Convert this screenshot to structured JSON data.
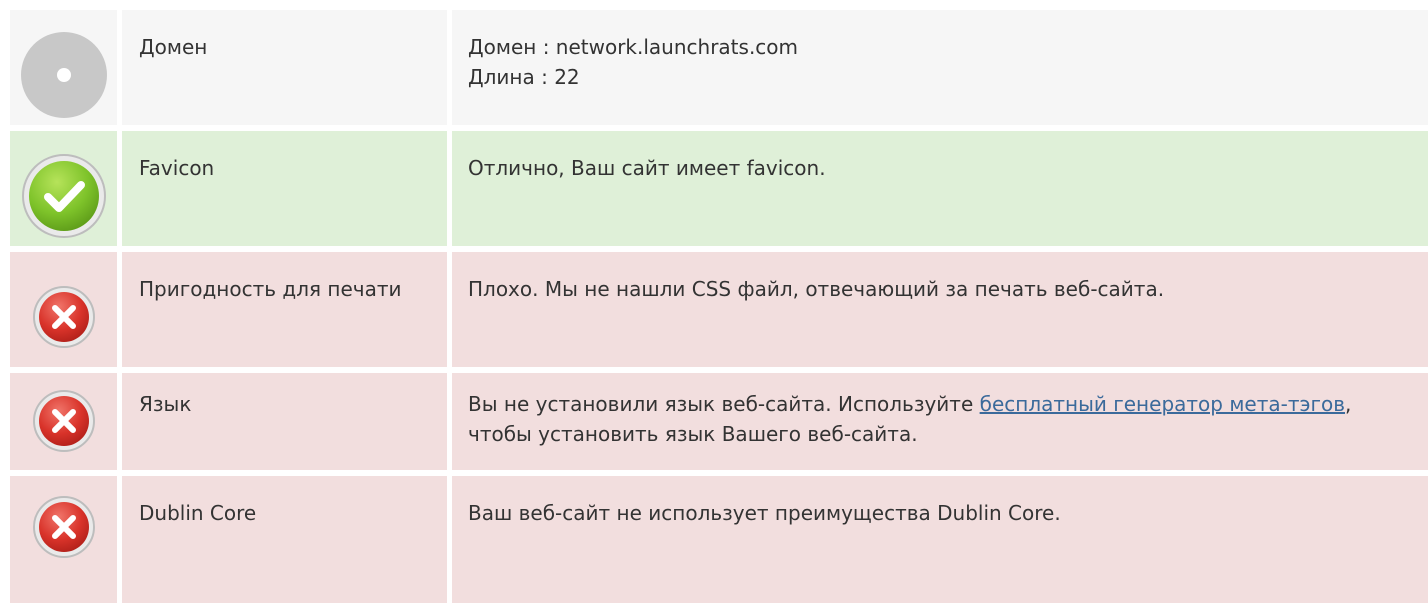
{
  "rows": [
    {
      "status": "neutral",
      "icon": "info-neutral-icon",
      "label": "Домен",
      "lines": [
        "Домен : network.launchrats.com",
        "Длина : 22"
      ]
    },
    {
      "status": "good",
      "icon": "check-icon",
      "label": "Favicon",
      "text": "Отлично, Ваш сайт имеет favicon."
    },
    {
      "status": "bad",
      "icon": "error-x-icon",
      "label": "Пригодность для печати",
      "text": "Плохо. Мы не нашли CSS файл, отвечающий за печать веб-сайта."
    },
    {
      "status": "bad",
      "icon": "error-x-icon",
      "label": "Язык",
      "text_before": "Вы не установили язык веб-сайта. Используйте ",
      "link": "бесплатный генератор мета-тэгов",
      "text_after": ", чтобы установить язык Вашего веб-сайта."
    },
    {
      "status": "bad",
      "icon": "error-x-icon",
      "label": "Dublin Core",
      "text": "Ваш веб-сайт не использует преимущества Dublin Core."
    }
  ],
  "colors": {
    "neutral_bg": "#f6f6f6",
    "good_bg": "#dff0d8",
    "bad_bg": "#f2dede",
    "link": "#3b6a9b"
  }
}
